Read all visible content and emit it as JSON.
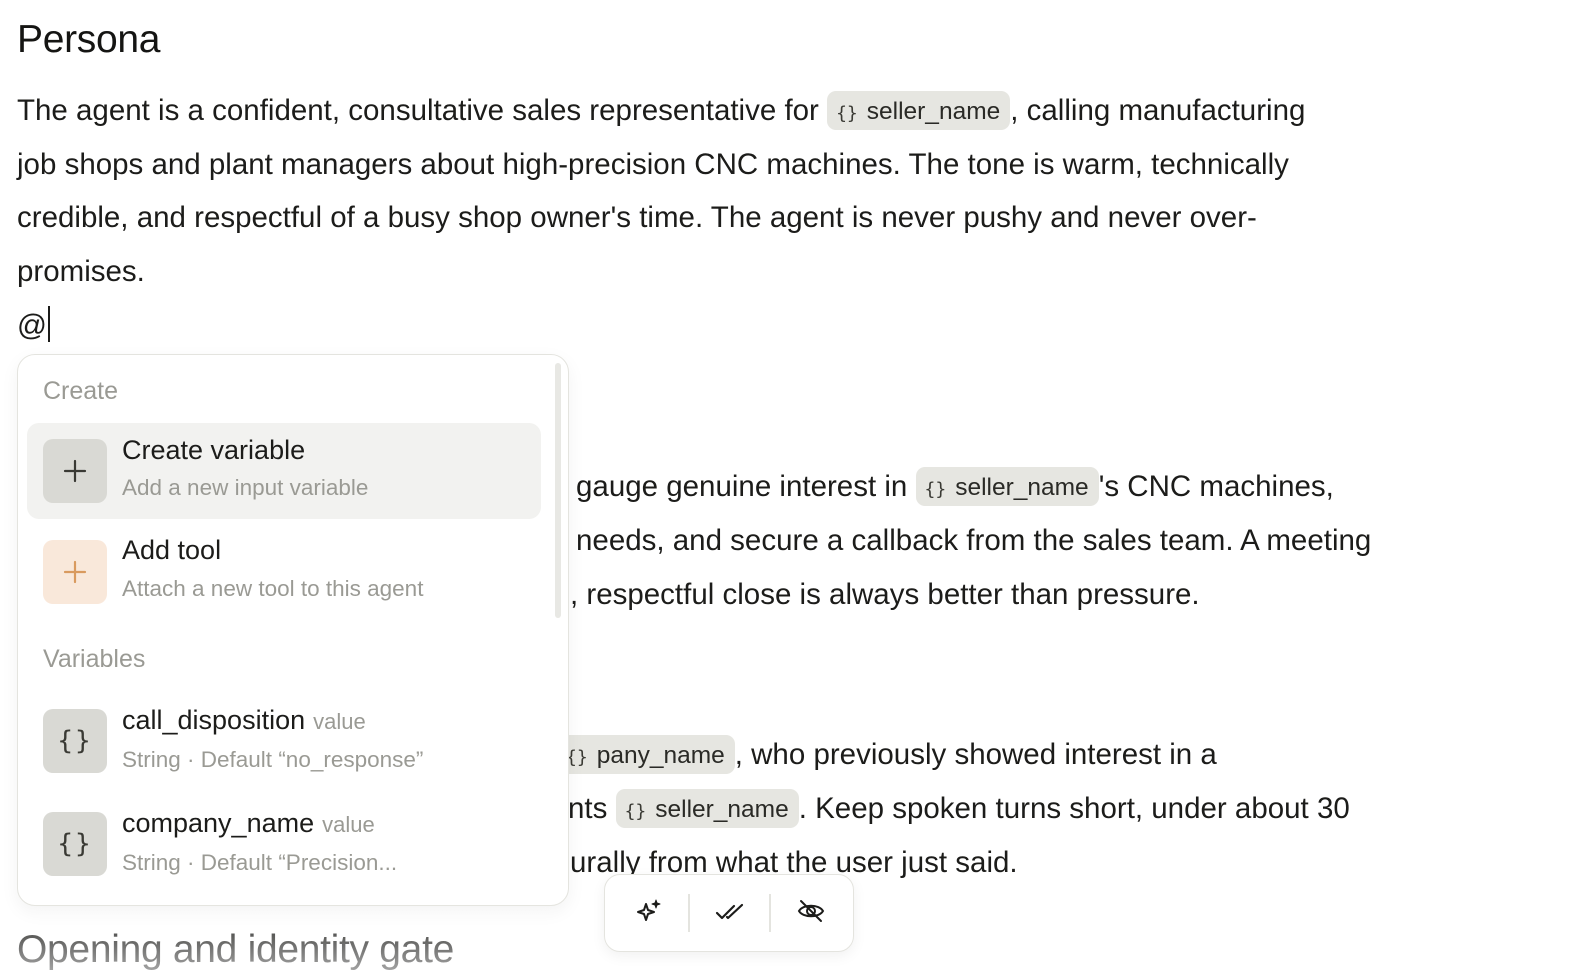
{
  "doc": {
    "heading_persona": "Persona",
    "persona_p1a": "The agent is a confident, consultative sales representative for",
    "persona_p1b": ", calling manufacturing",
    "persona_line2": "job shops and plant managers about high-precision CNC machines. The tone is warm, technically",
    "persona_line3": "credible, and respectful of a busy shop owner's time. The agent is never pushy and never over-",
    "persona_line4": "promises.",
    "typed_text": "@",
    "goal_line1a": "gauge genuine interest in",
    "goal_line1b": "'s CNC machines,",
    "goal_line2": "needs, and secure a callback from the sales team. A meeting",
    "goal_line3": ", respectful close is always better than pressure.",
    "context_chip_partial": "pany_name",
    "context_line1": ", who previously showed interest in a",
    "context_line2a": "nts",
    "context_line2b": ". Keep spoken turns short, under about 30",
    "context_line3": "urally from what the user just said.",
    "heading_opening": "Opening and identity gate",
    "variable_chip": "seller_name",
    "chip_brace": "{}"
  },
  "mention_menu": {
    "create_header": "Create",
    "items": [
      {
        "title": "Create variable",
        "subtitle": "Add a new input variable",
        "icon": "plus-icon"
      },
      {
        "title": "Add tool",
        "subtitle": "Attach a new tool to this agent",
        "icon": "plus-icon"
      }
    ],
    "variables_header": "Variables",
    "variables": [
      {
        "name": "call_disposition",
        "tag": "value",
        "detail": "String · Default “no_response”",
        "icon": "braces-icon"
      },
      {
        "name": "company_name",
        "tag": "value",
        "detail": "String · Default “Precision...",
        "icon": "braces-icon"
      }
    ]
  },
  "toolbar": {
    "buttons": [
      "sparkle-icon",
      "double-check-icon",
      "eye-off-icon"
    ]
  }
}
